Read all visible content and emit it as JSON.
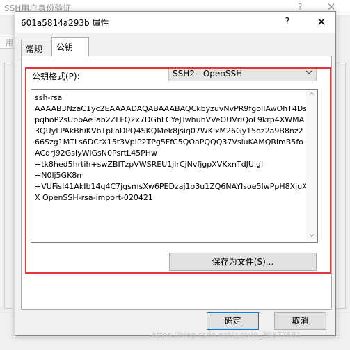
{
  "background_window": {
    "title": "SSH用户身份验证",
    "help_glyph": "?",
    "close_glyph": "✕",
    "tab_edge_label": "用"
  },
  "dialog": {
    "title": "601a5814a293b 属性",
    "help_glyph": "?",
    "close_glyph": "✕"
  },
  "tabs": [
    {
      "label": "常规",
      "active": false
    },
    {
      "label": "公钥",
      "active": true
    }
  ],
  "public_key": {
    "format_label": "公钥格式(P):",
    "format_value": "SSH2 - OpenSSH",
    "key_text": "ssh-rsa\nAAAAB3NzaC1yc2EAAAADAQABAAABAQCkbyzuvNvPR9fgoIIAwOhT4DspqhoP2sUbbAeTab2ZLFQ2x7DGhLCYeJTwhuhVVeOUVrlQoL9krp4XWMA3QUyLPAkBhiKVbTpLoDPQ4SKQMek8jsiq07WKlxM26Gy15oz2a9B8nz266Szg1MTLs6DCtX15t3VpIP2TPg5FfC5QOaPQQQ37VsluKAMQRimB5foACdrJ92GslyWlGsN0PsrtL45PHw\n+tk8hed5hrtih+swZBITzpVWSREU1jlrCjNvfjgpXVKxnTdJUigI\n+N0lj5GK8m\n+VUFisI41AkIb14q4C7jgsmsXw6PEDzaj1o3u1ZQ6NAYIsoe5IwPpH8XjuXX OpenSSH-rsa-import-020421",
    "save_button_label": "保存为文件(S)...",
    "highlight_color": "#e5373b"
  },
  "footer": {
    "ok_label": "确定",
    "cancel_label": "取消"
  },
  "watermark": "https://blog.csdn.net/weixin_39877681"
}
